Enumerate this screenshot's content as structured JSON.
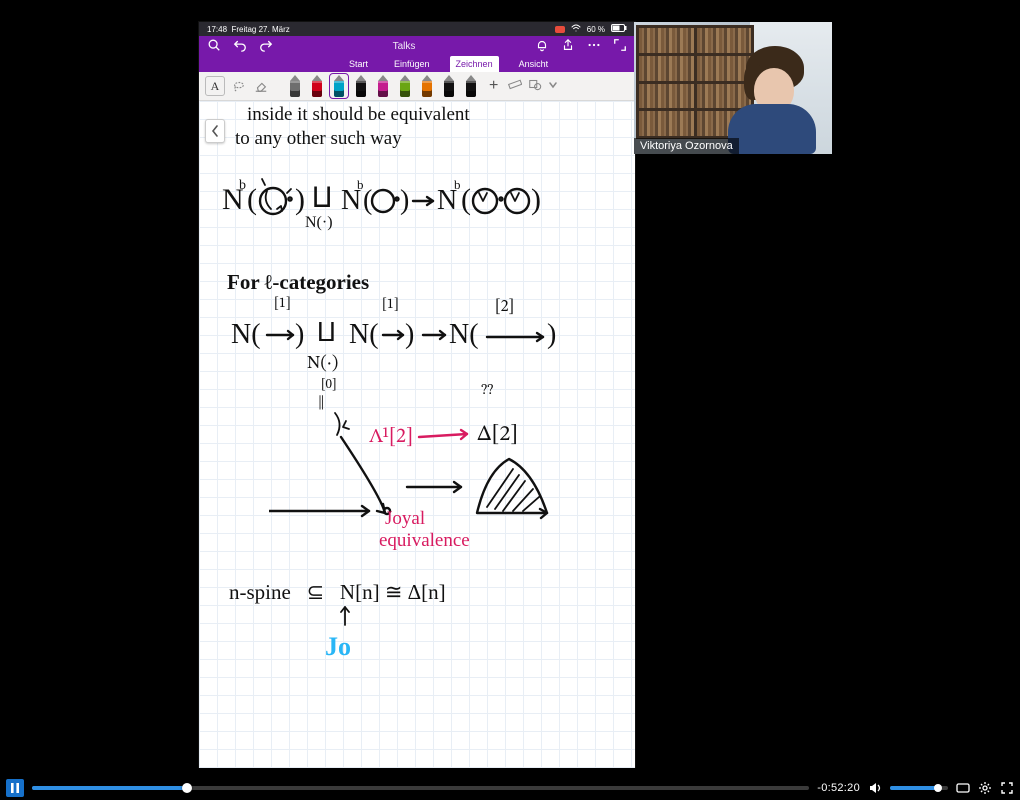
{
  "ipad_status": {
    "time": "17:48",
    "date": "Freitag 27. März",
    "battery": "60 %"
  },
  "onenote": {
    "doc_title": "Talks",
    "ribbon": {
      "start": "Start",
      "insert": "Einfügen",
      "draw": "Zeichnen",
      "view": "Ansicht"
    },
    "text_tool_label": "A",
    "pens": [
      {
        "color": "#6e6e6e"
      },
      {
        "color": "#d0021b"
      },
      {
        "color": "#00a3c7"
      },
      {
        "color": "#111111"
      },
      {
        "color": "#c41e8e"
      },
      {
        "color": "#6aa514"
      },
      {
        "color": "#e57300"
      },
      {
        "color": "#111111"
      },
      {
        "color": "#111111"
      }
    ]
  },
  "notes": {
    "line1": "inside it should be equivalent",
    "line2": "to any other such way",
    "formula1_left": "N",
    "formula1_coprod": "⨿",
    "formula1_under": "N(·)",
    "for_cats": "For ℓ-categories",
    "n_arrow": "N( → )",
    "n_big": "N(       → )",
    "bracket1": "[1]",
    "bracket1b": "[1]",
    "bracket2": "[2]",
    "n_under": "N(·)",
    "zero": "[0]",
    "double_bar": "‖",
    "double_q": "⁇",
    "horn": "Λ¹[2]",
    "delta2": "Δ[2]",
    "joyal": "Joyal",
    "equiv": "equivalence",
    "spine": "n-spine   ⊆   N[n] ≅ Δ[n]",
    "jo": "Jo"
  },
  "webcam": {
    "name": "Viktoriya Ozornova"
  },
  "player": {
    "time_remaining": "-0:52:20",
    "progress_pct": 20,
    "volume_pct": 82
  }
}
